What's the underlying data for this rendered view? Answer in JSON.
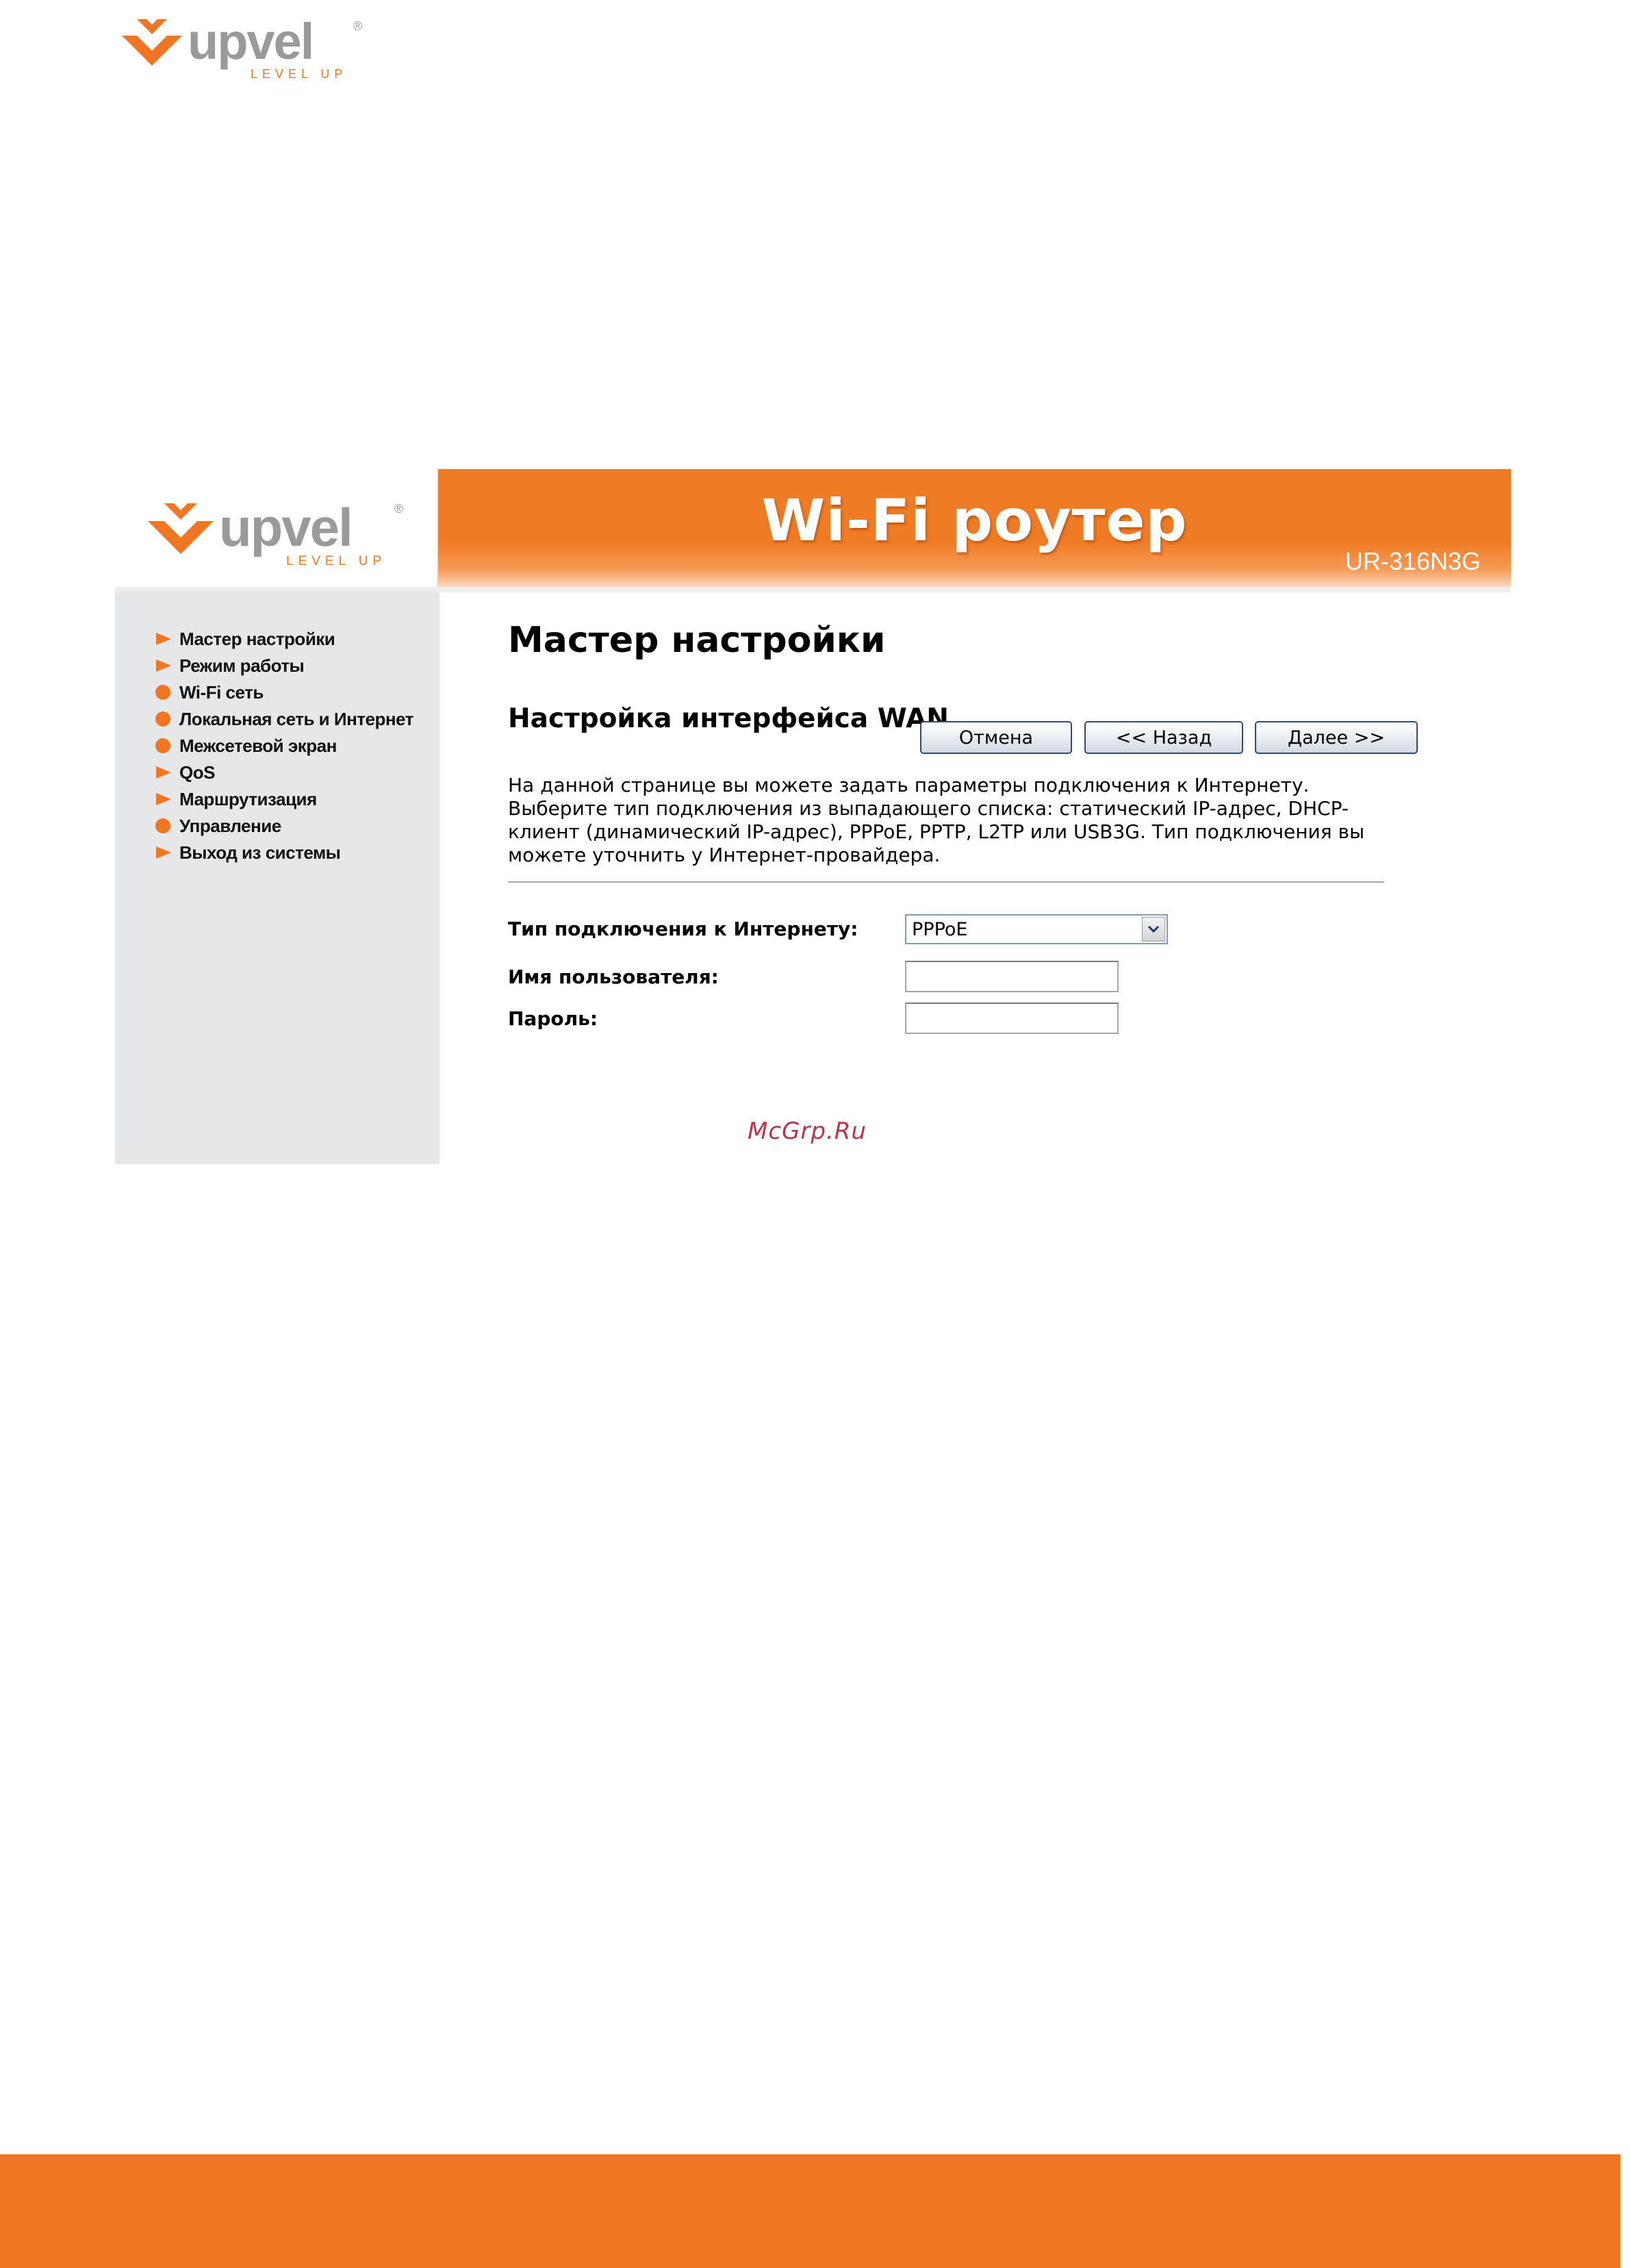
{
  "brand": {
    "name": "upvel",
    "tagline": "LEVEL UP",
    "registered_mark": "®"
  },
  "header": {
    "title": "Wi-Fi роутер",
    "model": "UR-316N3G"
  },
  "sidebar": {
    "items": [
      {
        "label": "Мастер настройки",
        "icon": "triangle-arrow-icon"
      },
      {
        "label": "Режим работы",
        "icon": "triangle-arrow-icon"
      },
      {
        "label": "Wi-Fi сеть",
        "icon": "circle-bullet-icon"
      },
      {
        "label": "Локальная сеть и Интернет",
        "icon": "circle-bullet-icon"
      },
      {
        "label": "Межсетевой экран",
        "icon": "circle-bullet-icon"
      },
      {
        "label": "QoS",
        "icon": "triangle-arrow-icon"
      },
      {
        "label": "Маршрутизация",
        "icon": "triangle-arrow-icon"
      },
      {
        "label": "Управление",
        "icon": "circle-bullet-icon"
      },
      {
        "label": "Выход из системы",
        "icon": "triangle-arrow-icon"
      }
    ]
  },
  "main": {
    "title": "Мастер настройки",
    "subtitle": "Настройка интерфейса WAN",
    "description_lines": [
      "На данной странице вы можете задать параметры подключения к Интернету.",
      "Выберите тип подключения из выпадающего списка: статический IP-адрес, DHCP-",
      "клиент (динамический IP-адрес), PPPoE, PPTP, L2TP или USB3G. Тип подключения вы",
      "можете уточнить у Интернет-провайдера."
    ],
    "form": {
      "connection_type_label": "Тип подключения к Интернету:",
      "connection_type_value": "PPPoE",
      "username_label": "Имя пользователя:",
      "username_value": "",
      "password_label": "Пароль:",
      "password_value": ""
    },
    "buttons": {
      "cancel": "Отмена",
      "back": "<< Назад",
      "next": "Далее >>"
    }
  },
  "watermark": "McGrp.Ru",
  "colors": {
    "accent": "#f07624",
    "sidebar_bg": "#e6e7e8",
    "logo_text": "#9a9a9a"
  }
}
